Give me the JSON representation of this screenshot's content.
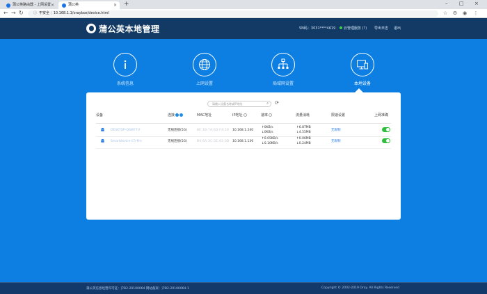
{
  "browser": {
    "tabs": [
      {
        "title": "蒲公英路由器 - 上网设置",
        "active": false
      },
      {
        "title": "蒲公英",
        "active": true
      }
    ],
    "new_tab": "+",
    "address": {
      "security": "不安全",
      "url": "10.168.1.1/oraybox/device.html"
    },
    "window_controls": [
      "–",
      "□",
      "×"
    ]
  },
  "header": {
    "title": "蒲公英本地管理",
    "sn_label": "SN码：3031****4619",
    "cloud_status": "云管理服务 (?)",
    "export_log": "导出日志",
    "logout": "退出"
  },
  "nav": {
    "items": [
      {
        "label": "系统信息",
        "icon": "info-icon",
        "active": false
      },
      {
        "label": "上网设置",
        "icon": "globe-icon",
        "active": false
      },
      {
        "label": "局域网设置",
        "icon": "lan-icon",
        "active": false
      },
      {
        "label": "本地设备",
        "icon": "monitor-icon",
        "active": true
      }
    ]
  },
  "device_panel": {
    "search_placeholder": "请输入设备名称或IP地址",
    "columns": {
      "device": "设备",
      "connection": "连接",
      "mac": "MAC地址",
      "ip": "IP地址",
      "rate": "速率",
      "traffic": "流量消耗",
      "speed_limit": "限速设置",
      "internet": "上网准确"
    },
    "rows": [
      {
        "name": "DESKTOP-Q6WF7U",
        "connection": "无线连接(5G)",
        "mac": "8E:1B:7A:6D:F4:28",
        "ip": "10.168.1.240",
        "rate_up": "0KB/s",
        "rate_down": "0KB/s",
        "traffic_up": "6.87MB",
        "traffic_down": "4.55MB",
        "limit": "无限制",
        "online": true
      },
      {
        "name": "Smartdevice-C5-Pro",
        "connection": "无线连接(5G)",
        "mac": "B4:6A:3C:5E:91:0D",
        "ip": "10.168.1.136",
        "rate_up": "0.05KB/s",
        "rate_down": "0.10KB/s",
        "traffic_up": "0.06MB",
        "traffic_down": "0.24MB",
        "limit": "无限制",
        "online": true
      }
    ]
  },
  "footer": {
    "icp": "蒲公英信息经营许可证：沪B2-20100064 网站备案：沪B2-20100064-1",
    "copyright": "Copyright © 2002-2019 Oray. All Rights Reserved"
  },
  "colors": {
    "page_bg": "#0d7fe2",
    "header_bg": "#123a64",
    "toggle_on": "#2ebd3c",
    "link": "#2a7de1"
  }
}
